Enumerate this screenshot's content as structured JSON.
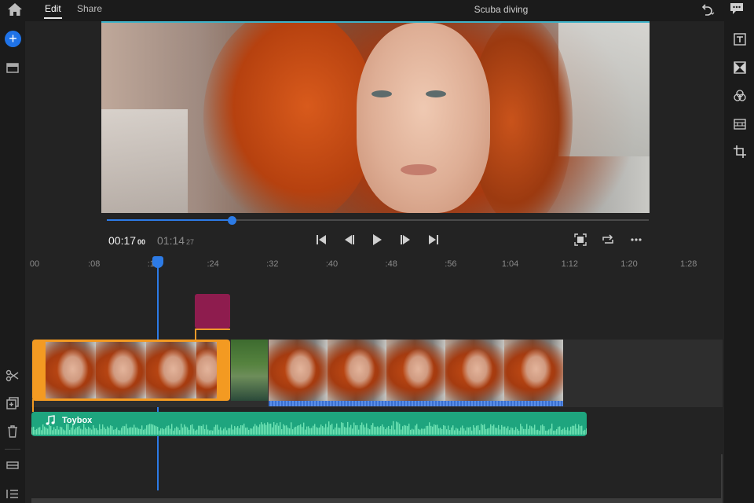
{
  "topbar": {
    "home_icon": "home-icon",
    "tabs": [
      {
        "label": "Edit",
        "active": true
      },
      {
        "label": "Share",
        "active": false
      }
    ],
    "project_title": "Scuba diving",
    "undo_icon": "undo-icon",
    "feedback_icon": "speech-bubble-icon"
  },
  "left_toolbar": {
    "add_icon": "plus-icon",
    "items": [
      "media-library-icon",
      "split-scissors-icon",
      "duplicate-icon",
      "trash-icon",
      "track-collapse-icon",
      "list-icon"
    ]
  },
  "right_toolbar": {
    "items": [
      "text-titles-icon",
      "transitions-icon",
      "color-icon",
      "speed-icon",
      "crop-icon"
    ]
  },
  "preview": {
    "progress": 0.23
  },
  "transport": {
    "current_time": "00:17",
    "current_frames": "00",
    "total_time": "01:14",
    "total_frames": "27",
    "controls": [
      "skip-to-start-icon",
      "step-back-icon",
      "play-icon",
      "step-forward-icon",
      "skip-to-end-icon"
    ],
    "options": [
      "fit-to-screen-icon",
      "loop-icon",
      "more-icon"
    ]
  },
  "ruler": {
    "ticks": [
      "00",
      ":08",
      ":16",
      ":24",
      ":32",
      ":40",
      ":48",
      ":56",
      "1:04",
      "1:12",
      "1:20",
      "1:28"
    ],
    "playhead_seconds": 17
  },
  "music": {
    "label": "Toybox",
    "color": "#1ea57e"
  },
  "colors": {
    "accent": "#2d7be6",
    "selection": "#f39a22",
    "title_clip": "#8e1c4e"
  }
}
